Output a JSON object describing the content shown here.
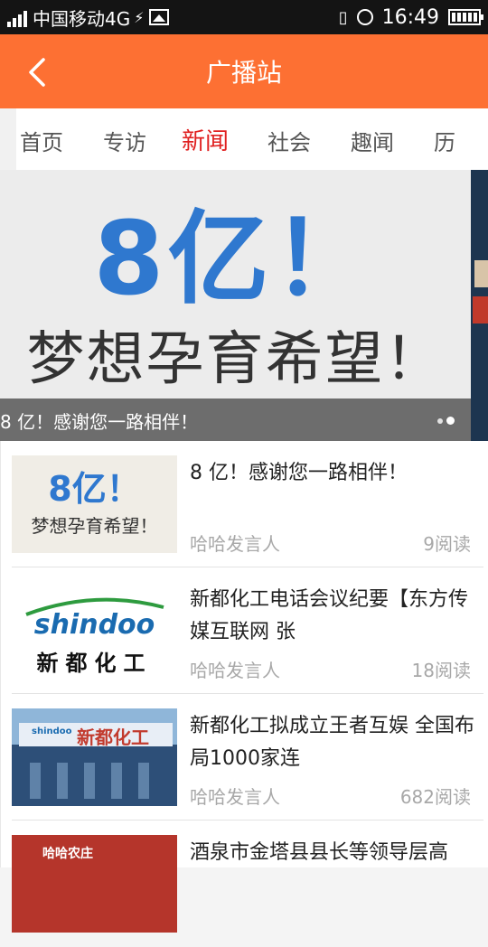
{
  "status_bar": {
    "network_badge": "4G",
    "carrier": "中国移动4G",
    "time": "16:49",
    "icons": [
      "signal-icon",
      "bolt-icon",
      "image-icon",
      "vibrate-icon",
      "alarm-icon",
      "battery-icon"
    ]
  },
  "app_bar": {
    "title": "广播站",
    "back_icon": "chevron-left-icon",
    "background": "#fd7033"
  },
  "tabs": {
    "items": [
      "首页",
      "专访",
      "新闻",
      "社会",
      "趣闻",
      "历"
    ],
    "active_index": 2,
    "active_color": "#e02020"
  },
  "banner": {
    "headline": "8亿！",
    "slogan": "梦想孕育希望！",
    "caption": "8 亿！感谢您一路相伴！",
    "page_count": 2,
    "active_page": 1
  },
  "articles": [
    {
      "title": "8 亿！感谢您一路相伴！",
      "source": "哈哈发言人",
      "reads": "9阅读",
      "thumb": {
        "line1": "8亿！",
        "line2": "梦想孕育希望！"
      }
    },
    {
      "title": "新都化工电话会议纪要【东方传媒互联网 张",
      "source": "哈哈发言人",
      "reads": "18阅读",
      "thumb": {
        "line1": "shindoo",
        "line2": "新都化工"
      }
    },
    {
      "title": "新都化工拟成立王者互娱 全国布局1000家连",
      "source": "哈哈发言人",
      "reads": "682阅读",
      "thumb": {
        "line1": "shindoo",
        "line2": "新都化工"
      }
    },
    {
      "title": "酒泉市金塔县县长等领导层高",
      "source": "",
      "reads": "",
      "thumb": {
        "line1": "哈哈农庄",
        "line2": ""
      }
    }
  ]
}
